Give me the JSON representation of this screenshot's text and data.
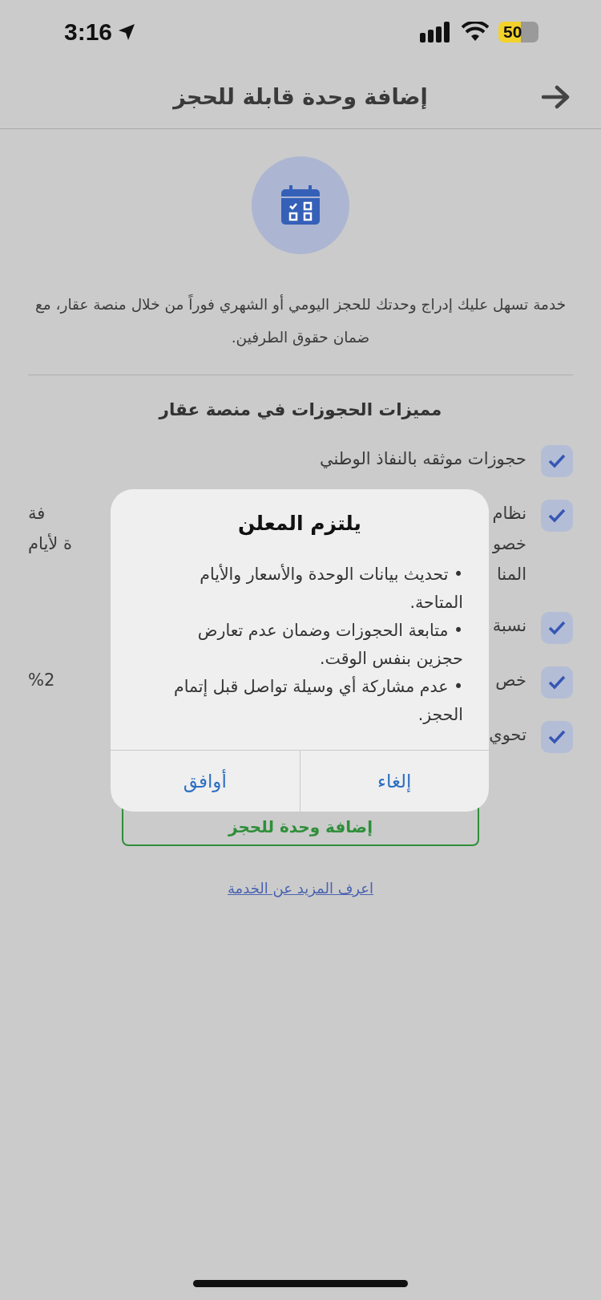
{
  "status_bar": {
    "time": "3:16",
    "battery": "50"
  },
  "header": {
    "title": "إضافة وحدة قابلة للحجز"
  },
  "intro": {
    "description": "خدمة تسهل عليك إدراج وحدتك للحجز اليومي أو الشهري فوراً من خلال منصة عقار، مع ضمان حقوق الطرفين."
  },
  "features": {
    "title": "مميزات الحجوزات في منصة عقار",
    "items": [
      {
        "checked": true,
        "lines": [
          {
            "right": "حجوزات موثقه بالنفاذ الوطني"
          }
        ]
      },
      {
        "checked": true,
        "lines": [
          {
            "right": "نظام",
            "left": "فة"
          },
          {
            "right": "خصو",
            "left": "ة لأيام"
          },
          {
            "right": "المنا"
          }
        ]
      },
      {
        "checked": true,
        "lines": [
          {
            "right": "نسبة"
          }
        ]
      },
      {
        "checked": true,
        "lines": [
          {
            "right": "خص",
            "left": "%2"
          }
        ]
      },
      {
        "checked": true,
        "lines": [
          {
            "right": "تحوي"
          }
        ]
      }
    ]
  },
  "add_unit_button": {
    "label": "إضافة وحدة للحجز"
  },
  "learn_more_link": "اعرف المزيد عن الخدمة",
  "dialog": {
    "title": "يلتزم المعلن",
    "items": [
      "• تحديث بيانات الوحدة والأسعار والأيام المتاحة.",
      "• متابعة الحجوزات وضمان عدم تعارض حجزين بنفس الوقت.",
      "• عدم مشاركة أي وسيلة تواصل قبل إتمام الحجز."
    ],
    "buttons": [
      {
        "label": "إلغاء"
      },
      {
        "label": "أوافق"
      }
    ]
  }
}
